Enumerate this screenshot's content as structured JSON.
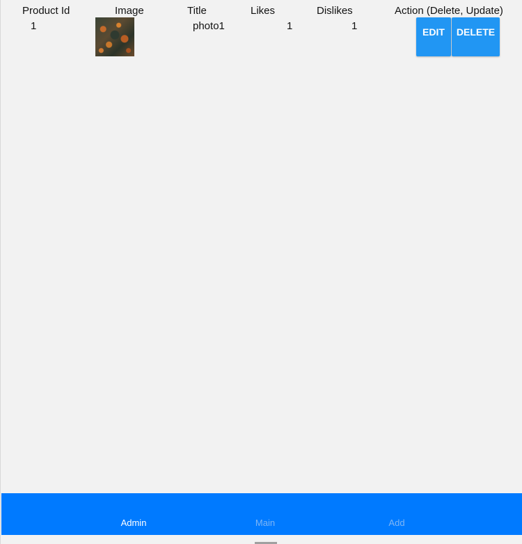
{
  "table": {
    "headers": {
      "product_id": "Product Id",
      "image": "Image",
      "title": "Title",
      "likes": "Likes",
      "dislikes": "Dislikes",
      "action": "Action (Delete, Update)"
    },
    "rows": [
      {
        "product_id": "1",
        "image_icon": "photo-thumbnail",
        "title": "photo1",
        "likes": "1",
        "dislikes": "1",
        "edit_label": "EDIT",
        "delete_label": "DELETE"
      }
    ]
  },
  "bottom_nav": {
    "items": [
      {
        "label": "Admin",
        "active": true
      },
      {
        "label": "Main",
        "active": false
      },
      {
        "label": "Add",
        "active": false
      }
    ]
  },
  "colors": {
    "background": "#f2f2f2",
    "button": "#2196f3",
    "nav_bar": "#007aff",
    "nav_active": "#ffffff",
    "nav_inactive": "#7fb6f5"
  }
}
